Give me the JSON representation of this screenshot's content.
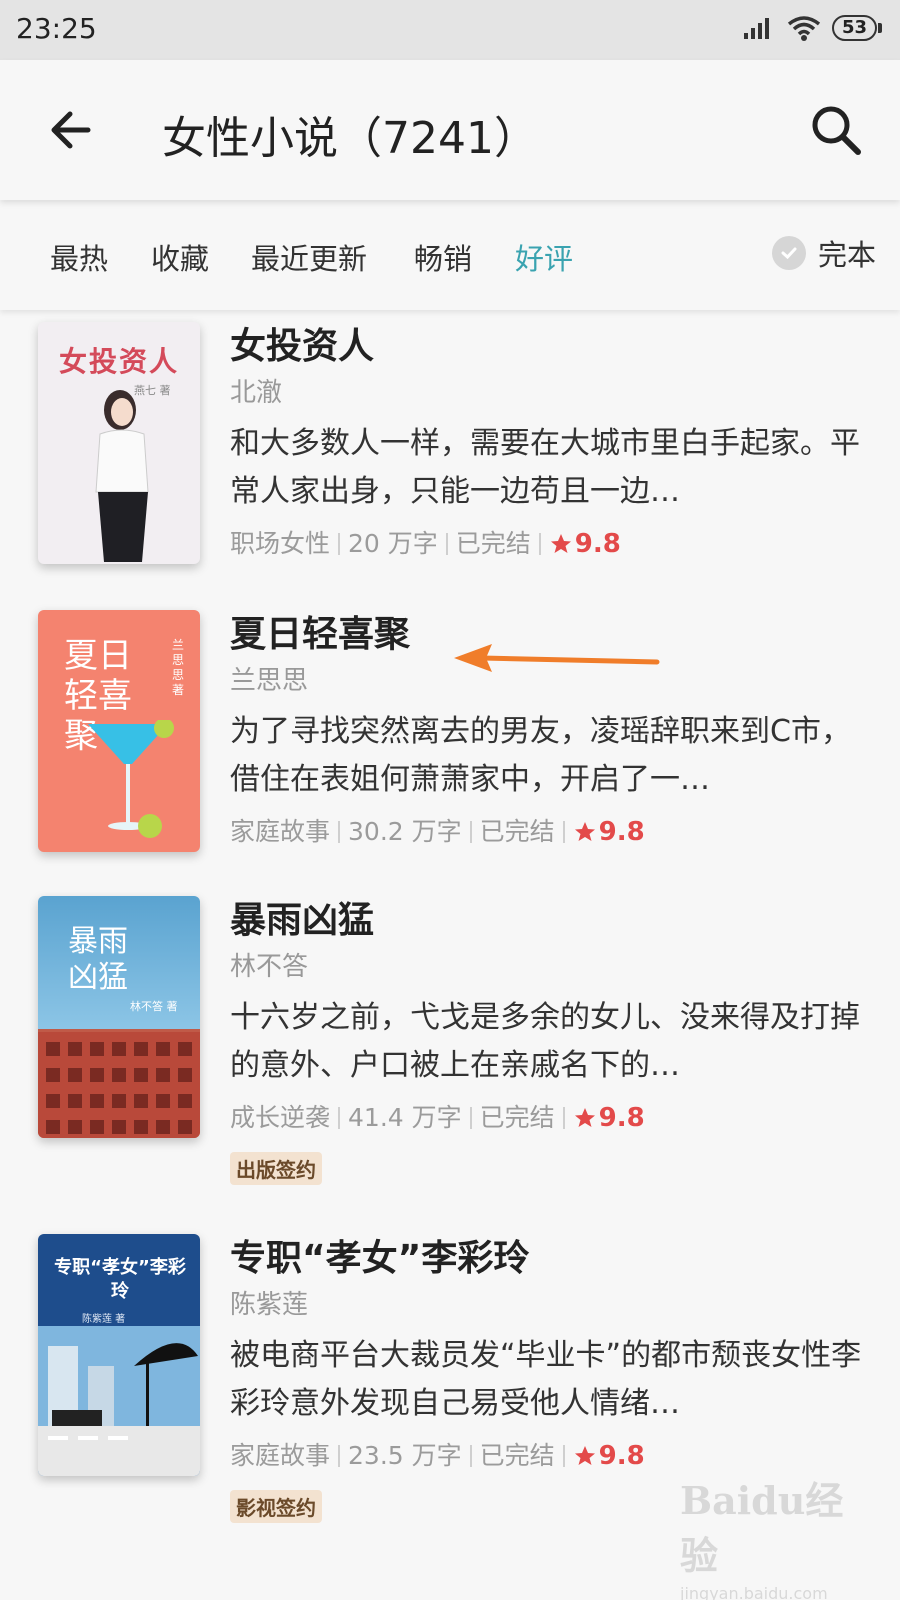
{
  "status_bar": {
    "time": "23:25",
    "battery": "53"
  },
  "header": {
    "title": "女性小说（7241）"
  },
  "filters": {
    "items": [
      {
        "label": "最热",
        "active": false
      },
      {
        "label": "收藏",
        "active": false
      },
      {
        "label": "最近更新",
        "active": false
      },
      {
        "label": "畅销",
        "active": false
      },
      {
        "label": "好评",
        "active": true
      }
    ],
    "complete_label": "完本"
  },
  "books": [
    {
      "title": "女投资人",
      "author": "北澈",
      "desc": "和大多数人一样，需要在大城市里白手起家。平常人家出身，只能一边苟且一边…",
      "genre": "职场女性",
      "words": "20 万字",
      "status": "已完结",
      "rating": "9.8",
      "badge": "",
      "cover_title": "女投资人",
      "cover_author": "燕七 著"
    },
    {
      "title": "夏日轻喜聚",
      "author": "兰思思",
      "desc": "为了寻找突然离去的男友，凌瑶辞职来到C市，借住在表姐何萧萧家中，开启了一…",
      "genre": "家庭故事",
      "words": "30.2 万字",
      "status": "已完结",
      "rating": "9.8",
      "badge": "",
      "cover_title": "夏日轻喜聚",
      "cover_author": "兰思思 著"
    },
    {
      "title": "暴雨凶猛",
      "author": "林不答",
      "desc": "十六岁之前，弋戈是多余的女儿、没来得及打掉的意外、户口被上在亲戚名下的…",
      "genre": "成长逆袭",
      "words": "41.4 万字",
      "status": "已完结",
      "rating": "9.8",
      "badge": "出版签约",
      "cover_title": "暴雨凶猛",
      "cover_author": "林不答 著"
    },
    {
      "title": "专职“孝女”李彩玲",
      "author": "陈紫莲",
      "desc": "被电商平台大裁员发“毕业卡”的都市颓丧女性李彩玲意外发现自己易受他人情绪…",
      "genre": "家庭故事",
      "words": "23.5 万字",
      "status": "已完结",
      "rating": "9.8",
      "badge": "影视签约",
      "cover_title": "专职“孝女”李彩玲",
      "cover_author": "陈紫莲 著"
    }
  ],
  "watermark": {
    "logo": "Baidu经验",
    "url": "jingyan.baidu.com"
  }
}
